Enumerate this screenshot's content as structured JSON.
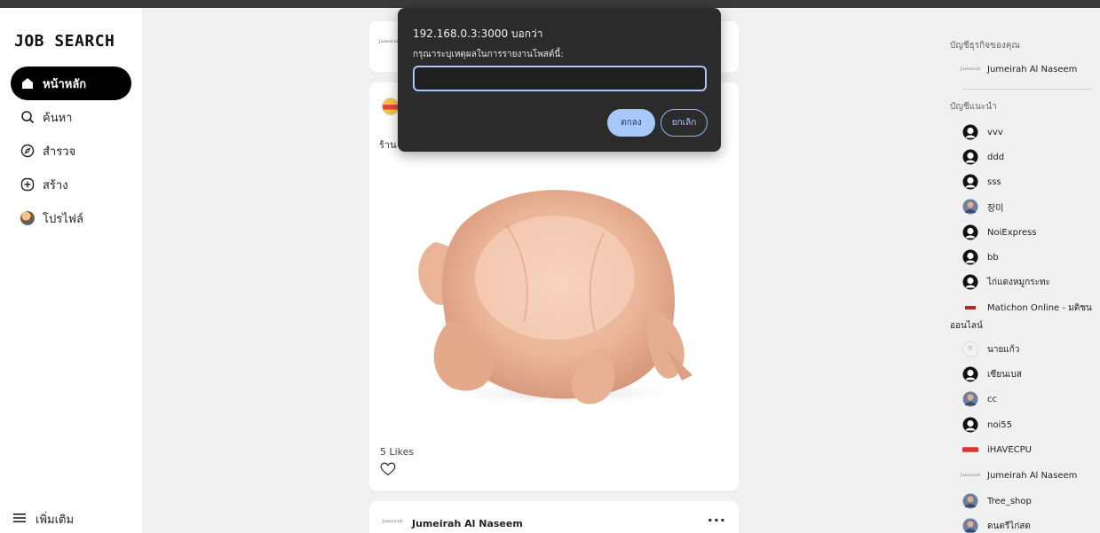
{
  "app": {
    "logo": "JOB SEARCH"
  },
  "nav": {
    "items": [
      {
        "label": "หน้าหลัก",
        "icon": "home-icon",
        "active": true
      },
      {
        "label": "ค้นหา",
        "icon": "search-icon"
      },
      {
        "label": "สำรวจ",
        "icon": "compass-icon"
      },
      {
        "label": "สร้าง",
        "icon": "plus-circle-icon"
      },
      {
        "label": "โปรไฟล์",
        "icon": "avatar-icon"
      }
    ],
    "more_label": "เพิ่มเติม"
  },
  "feed": {
    "top_card_logo": "Jumeirah",
    "main_post": {
      "caption": "ร้าน",
      "likes": "5 Likes",
      "image": "raw-chicken-image"
    },
    "bottom_post": {
      "logo": "Jumeirah",
      "author": "Jumeirah Al Naseem",
      "menu": "..."
    }
  },
  "right": {
    "business_heading": "บัญชีธุรกิจของคุณ",
    "business_account": "Jumeirah Al Naseem",
    "suggested_heading": "บัญชีแนะนำ",
    "suggested": [
      {
        "name": "vvv",
        "avatar": "default-user-icon"
      },
      {
        "name": "ddd",
        "avatar": "default-user-icon"
      },
      {
        "name": "sss",
        "avatar": "default-user-icon"
      },
      {
        "name": "장미",
        "avatar": "photo-avatar"
      },
      {
        "name": "NoiExpress",
        "avatar": "default-user-icon"
      },
      {
        "name": "bb",
        "avatar": "default-user-icon"
      },
      {
        "name": "ไก่แดงหมูกระทะ",
        "avatar": "default-user-icon"
      },
      {
        "name": "Matichon Online - มติชน",
        "avatar": "matichon-logo",
        "wrap": "ออนไลน์"
      },
      {
        "name": "นายแก้ว",
        "avatar": "light-avatar"
      },
      {
        "name": "เซียนเบส",
        "avatar": "default-user-icon"
      },
      {
        "name": "cc",
        "avatar": "photo-avatar"
      },
      {
        "name": "noi55",
        "avatar": "default-user-icon"
      },
      {
        "name": "iHAVECPU",
        "avatar": "ihavecpu-logo"
      },
      {
        "name": "Jumeirah Al Naseem",
        "avatar": "jumeirah-logo"
      },
      {
        "name": "Tree_shop",
        "avatar": "photo-avatar"
      },
      {
        "name": "ดนตรีไก่สด",
        "avatar": "photo-avatar"
      }
    ]
  },
  "dialog": {
    "title": "192.168.0.3:3000 บอกว่า",
    "message": "กรุณาระบุเหตุผลในการรายงานโพสต์นี้:",
    "input_value": "",
    "ok_label": "ตกลง",
    "cancel_label": "ยกเลิก"
  },
  "colors": {
    "accent": "#a8c7fa",
    "dialog_bg": "#2b2b2b",
    "nav_active": "#000000",
    "page_bg": "#f0f0f0"
  }
}
